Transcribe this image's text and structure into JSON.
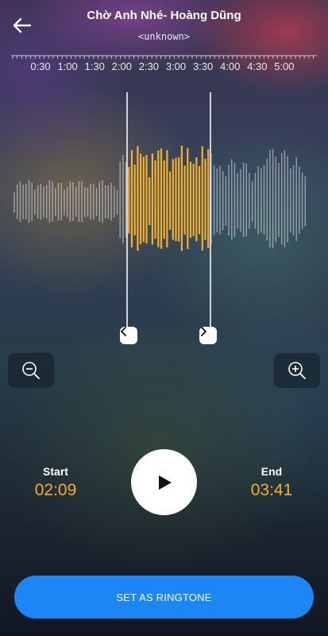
{
  "header": {
    "title": "Chờ Anh Nhé- Hoàng Dũng",
    "subtitle": "<unknown>"
  },
  "timeline": {
    "labels": [
      "0:30",
      "1:00",
      "1:30",
      "2:00",
      "2:30",
      "3:00",
      "3:30",
      "4:00",
      "4:30",
      "5:00"
    ]
  },
  "selection": {
    "start_label": "Start",
    "start_time": "02:09",
    "end_label": "End",
    "end_time": "03:41"
  },
  "actions": {
    "set_ringtone_label": "SET AS RINGTONE"
  },
  "colors": {
    "accent": "#f4b02a",
    "primary_button": "#1d86f5"
  },
  "icons": {
    "back": "arrow-left-icon",
    "zoom_out": "zoom-out-icon",
    "zoom_in": "zoom-in-icon",
    "play": "play-icon",
    "handle_left": "chevron-left-icon",
    "handle_right": "chevron-right-icon"
  }
}
